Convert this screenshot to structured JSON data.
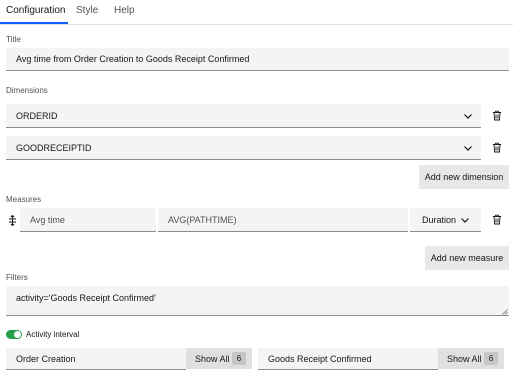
{
  "tabs": [
    {
      "label": "Configuration",
      "active": true
    },
    {
      "label": "Style",
      "active": false
    },
    {
      "label": "Help",
      "active": false
    }
  ],
  "title": {
    "label": "Title",
    "value": "Avg time from Order Creation to Goods Receipt Confirmed"
  },
  "dimensions": {
    "label": "Dimensions",
    "items": [
      "ORDERID",
      "GOODRECEIPTID"
    ],
    "add_label": "Add new dimension"
  },
  "measures": {
    "label": "Measures",
    "name": "Avg time",
    "expression": "AVG(PATHTIME)",
    "format": "Duration",
    "add_label": "Add new measure"
  },
  "filters": {
    "label": "Filters",
    "value": "activity='Goods Receipt Confirmed'"
  },
  "activity_interval": {
    "label": "Activity interval",
    "enabled": true,
    "from": {
      "value": "Order Creation",
      "show_all_label": "Show All",
      "count": "6"
    },
    "to": {
      "value": "Goods Receipt Confirmed",
      "show_all_label": "Show All",
      "count": "6"
    }
  },
  "colors": {
    "accent": "#0f62fe",
    "toggle_on": "#24a148",
    "field_bg": "#f4f4f4",
    "button_bg": "#e8e8e8"
  },
  "icons": {
    "chevron": "chevron-down-icon",
    "delete": "trash-icon",
    "drag": "drag-handle-icon",
    "resize": "resize-handle-icon"
  }
}
